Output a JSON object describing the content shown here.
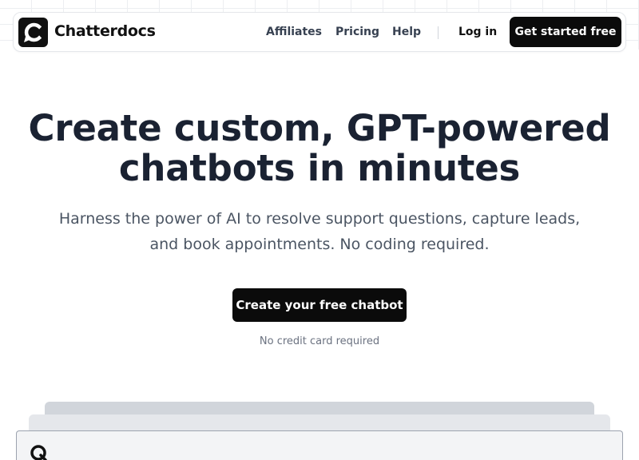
{
  "brand": {
    "name": "Chatterdocs",
    "logo_icon": "chat-bubble-logo-icon",
    "color": "#111111"
  },
  "nav": {
    "links": [
      {
        "label": "Affiliates"
      },
      {
        "label": "Pricing"
      },
      {
        "label": "Help"
      }
    ],
    "login_label": "Log in",
    "cta_label": "Get started free"
  },
  "hero": {
    "title_line1": "Create custom, GPT-powered",
    "title_line2": "chatbots in minutes",
    "subtitle": "Harness the power of AI to resolve support questions, capture leads, and book appointments. No coding required.",
    "cta_label": "Create your free chatbot",
    "note": "No credit card required"
  },
  "preview": {
    "icon": "chatbot-logo-icon"
  },
  "colors": {
    "primary_button": "#0b0b0b",
    "title_text": "#1a2232",
    "body_text": "#4b5563"
  }
}
